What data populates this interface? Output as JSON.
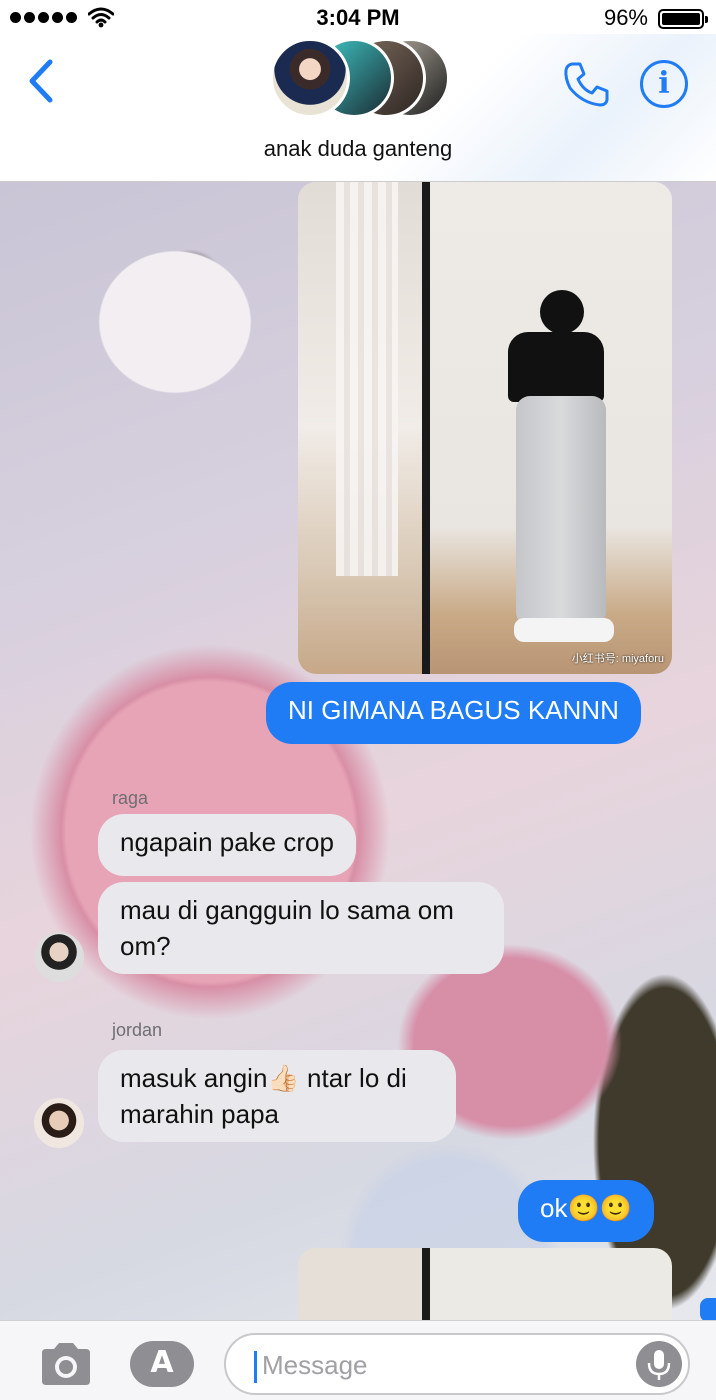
{
  "status_bar": {
    "time": "3:04 PM",
    "battery": "96%"
  },
  "header": {
    "group_name": "anak duda ganteng"
  },
  "photo": {
    "watermark": "小红书号: miyaforu"
  },
  "messages": {
    "sent_1": "NI GIMANA BAGUS KANNN",
    "raga_name": "raga",
    "raga_1": "ngapain pake crop",
    "raga_2": "mau di gangguin lo sama om om?",
    "jordan_name": "jordan",
    "jordan_1": "masuk angin👍🏻 ntar lo di marahin papa",
    "sent_2": "ok🙂🙂"
  },
  "input": {
    "placeholder": "Message"
  },
  "icons": [
    "back-chevron-icon",
    "phone-icon",
    "info-icon",
    "camera-icon",
    "app-store-icon",
    "microphone-icon",
    "wifi-icon",
    "battery-icon"
  ],
  "colors": {
    "accent": "#1f7cf5",
    "received_bubble": "#e9e9ed"
  }
}
